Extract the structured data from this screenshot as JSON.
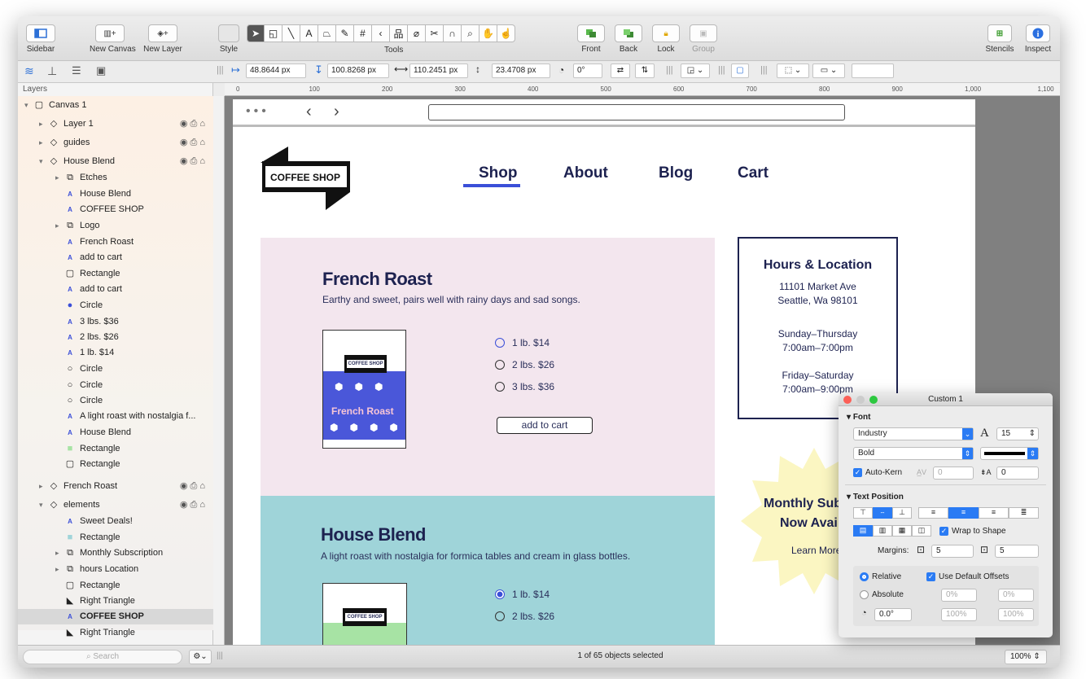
{
  "toolbar": {
    "sidebar": "Sidebar",
    "new_canvas": "New Canvas",
    "new_layer": "New Layer",
    "style": "Style",
    "tools": "Tools",
    "front": "Front",
    "back": "Back",
    "lock": "Lock",
    "group": "Group",
    "stencils": "Stencils",
    "inspect": "Inspect"
  },
  "inspector": {
    "x": "48.8644 px",
    "y": "100.8268 px",
    "w": "110.2451 px",
    "h": "23.4708 px",
    "angle": "0°"
  },
  "sidebar": {
    "title": "Layers",
    "rows": [
      {
        "label": "Canvas 1",
        "indent": 0,
        "icon": "▢"
      },
      {
        "label": "Layer 1",
        "indent": 1,
        "icon": "◇"
      },
      {
        "label": "guides",
        "indent": 1,
        "icon": "◇"
      },
      {
        "label": "House Blend",
        "indent": 1,
        "icon": "◇"
      },
      {
        "label": "Etches",
        "indent": 2,
        "icon": "⧉"
      },
      {
        "label": "House Blend",
        "indent": 2,
        "icon": "A"
      },
      {
        "label": "COFFEE SHOP",
        "indent": 2,
        "icon": "A"
      },
      {
        "label": "Logo",
        "indent": 2,
        "icon": "⧉"
      },
      {
        "label": "French Roast",
        "indent": 2,
        "icon": "A"
      },
      {
        "label": "add to cart",
        "indent": 2,
        "icon": "A"
      },
      {
        "label": "Rectangle",
        "indent": 2,
        "icon": "▢"
      },
      {
        "label": "add to cart",
        "indent": 2,
        "icon": "A"
      },
      {
        "label": "Circle",
        "indent": 2,
        "icon": "●"
      },
      {
        "label": "3 lbs. $36",
        "indent": 2,
        "icon": "A"
      },
      {
        "label": "2 lbs. $26",
        "indent": 2,
        "icon": "A"
      },
      {
        "label": "1 lb. $14",
        "indent": 2,
        "icon": "A"
      },
      {
        "label": "Circle",
        "indent": 2,
        "icon": "○"
      },
      {
        "label": "Circle",
        "indent": 2,
        "icon": "○"
      },
      {
        "label": "Circle",
        "indent": 2,
        "icon": "○"
      },
      {
        "label": "A light roast with nostalgia f...",
        "indent": 2,
        "icon": "A"
      },
      {
        "label": "House Blend",
        "indent": 2,
        "icon": "A"
      },
      {
        "label": "Rectangle",
        "indent": 2,
        "icon": "■"
      },
      {
        "label": "Rectangle",
        "indent": 2,
        "icon": "▢"
      },
      {
        "label": "French Roast",
        "indent": 1,
        "icon": "◇"
      },
      {
        "label": "elements",
        "indent": 1,
        "icon": "◇"
      },
      {
        "label": "Sweet Deals!",
        "indent": 2,
        "icon": "A"
      },
      {
        "label": "Rectangle",
        "indent": 2,
        "icon": "■"
      },
      {
        "label": "Monthly Subscription",
        "indent": 2,
        "icon": "⧉"
      },
      {
        "label": "hours Location",
        "indent": 2,
        "icon": "⧉"
      },
      {
        "label": "Rectangle",
        "indent": 2,
        "icon": "▢"
      },
      {
        "label": "Right Triangle",
        "indent": 2,
        "icon": "◣"
      },
      {
        "label": "COFFEE SHOP",
        "indent": 2,
        "icon": "A"
      },
      {
        "label": "Right Triangle",
        "indent": 2,
        "icon": "◣"
      }
    ],
    "search_placeholder": "Search"
  },
  "ruler": {
    "ticks": [
      "0",
      "100",
      "200",
      "300",
      "400",
      "500",
      "600",
      "700",
      "800",
      "900",
      "1,000",
      "1,100"
    ]
  },
  "page": {
    "logo": "COFFEE SHOP",
    "nav": {
      "shop": "Shop",
      "about": "About",
      "blog": "Blog",
      "cart": "Cart"
    },
    "french": {
      "title": "French Roast",
      "desc": "Earthy and sweet, pairs well with rainy days and sad songs.",
      "package_label": "French Roast",
      "package_logo": "COFFEE SHOP",
      "options": [
        "1 lb. $14",
        "2 lbs. $26",
        "3 lbs. $36"
      ],
      "cart": "add to cart"
    },
    "house": {
      "title": "House Blend",
      "desc": "A light roast with nostalgia for formica tables and cream in glass bottles.",
      "package_logo": "COFFEE SHOP",
      "options": [
        "1 lb. $14",
        "2 lbs. $26"
      ]
    },
    "hours": {
      "title": "Hours & Location",
      "addr1": "11101 Market Ave",
      "addr2": "Seattle, Wa 98101",
      "days1": "Sunday–Thursday",
      "time1": "7:00am–7:00pm",
      "days2": "Friday–Saturday",
      "time2": "7:00am–9:00pm"
    },
    "sub": {
      "line1": "Monthly Subscr",
      "line2": "Now Availab",
      "learn": "Learn More"
    }
  },
  "panel": {
    "title": "Custom 1",
    "font_section": "Font",
    "font": "Industry",
    "size": "15",
    "weight": "Bold",
    "autokern": "Auto-Kern",
    "kern": "0",
    "baseline": "0",
    "text_position": "Text Position",
    "wrap": "Wrap to Shape",
    "margins_label": "Margins:",
    "margin1": "5",
    "margin2": "5",
    "relative": "Relative",
    "absolute": "Absolute",
    "default_offsets": "Use Default Offsets",
    "rotation": "0.0°",
    "off1": "0%",
    "off2": "0%",
    "scale1": "100%",
    "scale2": "100%"
  },
  "status": {
    "selected": "1 of 65 objects selected",
    "zoom": "100%"
  },
  "colors": {
    "accent": "#3b4fd8",
    "french_bg": "#f3e6ee",
    "house_bg": "#9fd4d9",
    "navy": "#1d2250",
    "starburst": "#fbf6c2"
  }
}
